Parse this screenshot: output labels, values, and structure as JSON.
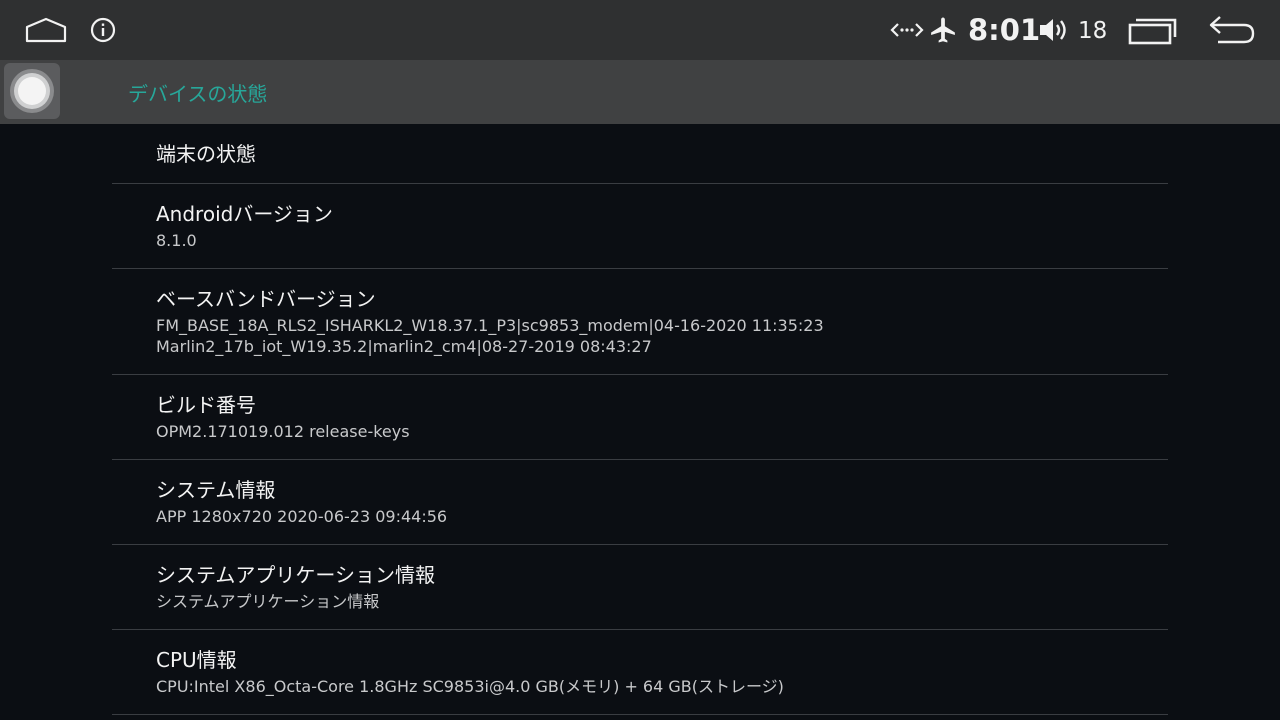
{
  "statusbar": {
    "time": "8:01",
    "volume_level": "18",
    "icons": {
      "home": "home-icon",
      "info": "info-icon",
      "link": "data-link-icon",
      "airplane": "airplane-mode-icon",
      "volume": "volume-icon",
      "recents": "recent-apps-icon",
      "back": "back-icon"
    }
  },
  "toolbar": {
    "title": "デバイスの状態",
    "accent_color": "#27a79a"
  },
  "items": [
    {
      "title": "端末の状態",
      "lines": []
    },
    {
      "title": "Androidバージョン",
      "lines": [
        "8.1.0"
      ]
    },
    {
      "title": "ベースバンドバージョン",
      "lines": [
        "FM_BASE_18A_RLS2_ISHARKL2_W18.37.1_P3|sc9853_modem|04-16-2020 11:35:23",
        "Marlin2_17b_iot_W19.35.2|marlin2_cm4|08-27-2019 08:43:27"
      ]
    },
    {
      "title": "ビルド番号",
      "lines": [
        "OPM2.171019.012 release-keys"
      ]
    },
    {
      "title": "システム情報",
      "lines": [
        "APP 1280x720 2020-06-23 09:44:56"
      ]
    },
    {
      "title": "システムアプリケーション情報",
      "lines": [
        "システムアプリケーション情報"
      ]
    },
    {
      "title": "CPU情報",
      "lines": [
        "CPU:Intel X86_Octa-Core 1.8GHz SC9853i@4.0 GB(メモリ) + 64 GB(ストレージ)"
      ]
    }
  ]
}
